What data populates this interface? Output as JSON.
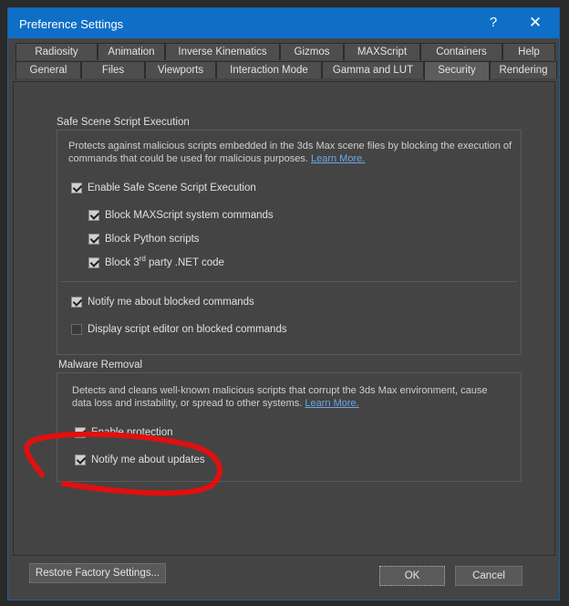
{
  "window": {
    "title": "Preference Settings",
    "help_label": "?",
    "close_label": "✕"
  },
  "tabs_row1": [
    "Radiosity",
    "Animation",
    "Inverse Kinematics",
    "Gizmos",
    "MAXScript",
    "Containers",
    "Help"
  ],
  "tabs_row2": [
    "General",
    "Files",
    "Viewports",
    "Interaction Mode",
    "Gamma and LUT",
    "Security",
    "Rendering"
  ],
  "active_tab": "Security",
  "safe_scene": {
    "title": "Safe Scene Script Execution",
    "desc_line1": "Protects against malicious scripts embedded in the 3ds Max scene files by blocking the execution of",
    "desc_line2": "commands that could be used for malicious purposes.",
    "learn_more": "Learn More.",
    "enable_label": "Enable Safe Scene Script Execution",
    "block_maxscript": "Block MAXScript system commands",
    "block_python": "Block Python scripts",
    "block_net_pre": "Block 3",
    "block_net_sup": "rd",
    "block_net_post": " party .NET code",
    "notify_blocked": "Notify me about blocked commands",
    "display_editor": "Display script editor on blocked commands"
  },
  "malware": {
    "title": "Malware Removal",
    "desc_line1": "Detects and cleans well-known malicious scripts that corrupt the 3ds Max environment, cause",
    "desc_line2": "data loss and instability, or spread to other systems.",
    "learn_more": "Learn More.",
    "enable_protection": "Enable protection",
    "notify_updates": "Notify me about updates"
  },
  "checkbox_states": {
    "enable_safe": true,
    "block_maxscript": true,
    "block_python": true,
    "block_net": true,
    "notify_blocked": true,
    "display_editor": false,
    "enable_protection": true,
    "notify_updates": true
  },
  "buttons": {
    "restore": "Restore Factory Settings...",
    "ok": "OK",
    "cancel": "Cancel"
  },
  "colors": {
    "titlebar": "#0f6fc6",
    "background": "#444444",
    "link": "#6aa8e6",
    "annotation": "#e01010"
  }
}
